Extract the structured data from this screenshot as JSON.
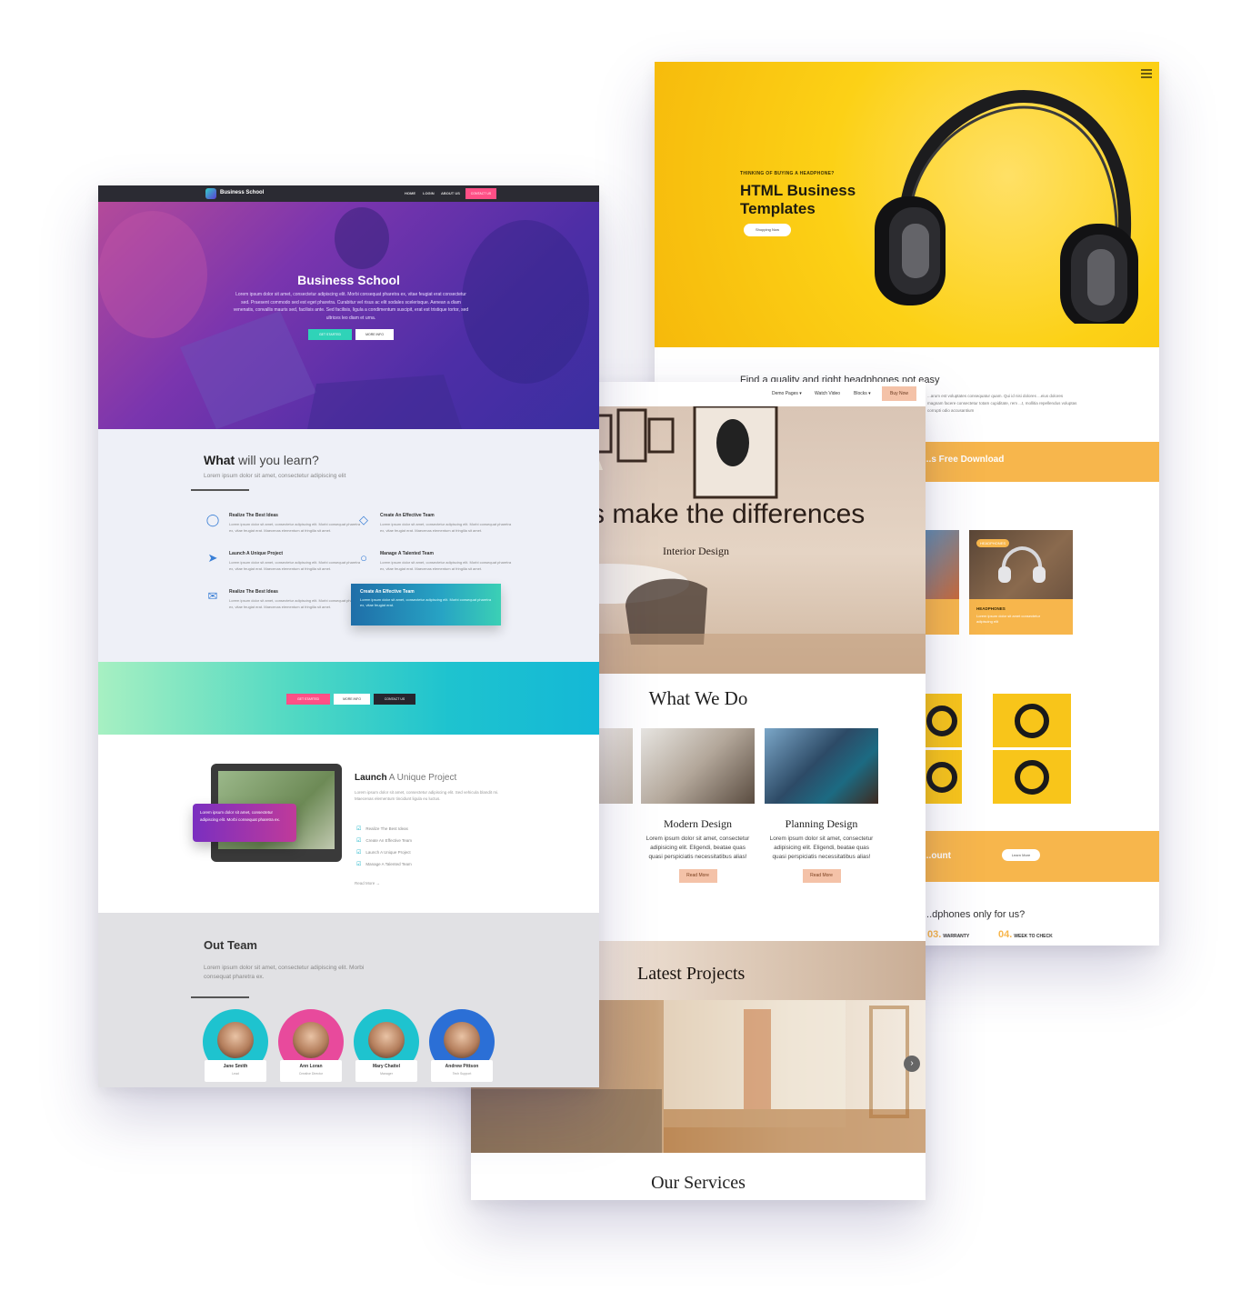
{
  "headphones_template": {
    "kicker": "THINKING OF BUYING A HEADPHONE?",
    "title": "HTML Business Templates",
    "shop_button": "Shopping Now",
    "intro_heading": "Find a quality and right headphones not easy",
    "intro_text": "...arum est voluptates consequatur quam. Qui id nisi dolores ...eius dolores magnam facere consectetur totam cupiditate, rem ...t, mollitia repellendus voluptas corrupti odio accusantium",
    "download_band": "...s Free Download",
    "product": {
      "tag": "HEADPHONES",
      "name": "HEADPHONES",
      "desc": "Lorem ipsum dolor sit amet consectetur adipiscing elit"
    },
    "discount_band": "...ount",
    "learn_more": "Learn More",
    "question": "...dphones only for us?",
    "stats": [
      {
        "num": "03.",
        "label": "WARRANTY"
      },
      {
        "num": "04.",
        "label": "WEEK TO CHECK"
      }
    ],
    "accent": "#f7b64c"
  },
  "interior_template": {
    "nav": {
      "demo_pages": "Demo Pages ▾",
      "watch_video": "Watch Video",
      "blocks": "Blocks ▾",
      "buy_now": "Buy Now"
    },
    "hero_title": "s make the differences",
    "hero_subtitle": "Interior Design",
    "what_we_do": "What We Do",
    "services": [
      {
        "name": "Modern Design",
        "desc": "Lorem ipsum dolor sit amet, consectetur adipisicing elit. Eligendi, beatae quas quasi perspiciatis necessitatibus alias!",
        "button": "Read More"
      },
      {
        "name": "Planning Design",
        "desc": "Lorem ipsum dolor sit amet, consectetur adipisicing elit. Eligendi, beatae quas quasi perspiciatis necessitatibus alias!",
        "button": "Read More"
      }
    ],
    "latest_projects": "Latest Projects",
    "our_services": "Our Services",
    "accent": "#f4c2a8"
  },
  "business_template": {
    "nav": {
      "brand": "Business School",
      "links": [
        "HOME",
        "LOGIN",
        "ABOUT US"
      ],
      "contact": "CONTACT US"
    },
    "hero": {
      "title": "Business School",
      "desc": "Lorem ipsum dolor sit amet, consectetur adipiscing elit. Morbi consequat pharetra ex, vitae feugiat erat consectetur sed. Praesent commodo sed est eget pharetra. Curabitur vel risus ac elit sodales scelerisque. Aenean a diam venenatis, convallis mauris sed, facilisis ante. Sed facilisis, ligula a condimentum suscipit, erat est tristique tortor, sed ultrices leo diam et urna.",
      "btn1": "GET STARTED",
      "btn2": "MORE INFO"
    },
    "learn": {
      "heading_bold": "What",
      "heading_rest": " will you learn?",
      "sub": "Lorem ipsum dolor sit amet, consectetur adipiscing elit",
      "features": [
        {
          "title": "Realize The Best Ideas",
          "desc": "Lorem ipsum dolor sit amet, consectetur adipiscing elit. Morbi consequat pharetra ex, vitae feugiat erat. Maecenas elementum at fringilla sit amet."
        },
        {
          "title": "Create An Effective Team",
          "desc": "Lorem ipsum dolor sit amet, consectetur adipiscing elit. Morbi consequat pharetra ex, vitae feugiat erat. Maecenas elementum at fringilla sit amet."
        },
        {
          "title": "Launch A Unique Project",
          "desc": "Lorem ipsum dolor sit amet, consectetur adipiscing elit. Morbi consequat pharetra ex, vitae feugiat erat. Maecenas elementum at fringilla sit amet."
        },
        {
          "title": "Manage A Talented Team",
          "desc": "Lorem ipsum dolor sit amet, consectetur adipiscing elit. Morbi consequat pharetra ex, vitae feugiat erat. Maecenas elementum at fringilla sit amet."
        },
        {
          "title": "Realize The Best Ideas",
          "desc": "Lorem ipsum dolor sit amet, consectetur adipiscing elit. Morbi consequat pharetra ex, vitae feugiat erat. Maecenas elementum at fringilla sit amet."
        }
      ],
      "card": {
        "title": "Create An Effective Team",
        "desc": "Lorem ipsum dolor sit amet, consectetur adipiscing elit. Morbi consequat pharetra ex, vitae feugiat erat."
      }
    },
    "band_buttons": [
      "GET STARTED",
      "MORE INFO",
      "CONTACT US"
    ],
    "launch": {
      "title_bold": "Launch",
      "title_rest": " A Unique Project",
      "desc": "Lorem ipsum dolor sit amet, consectetur adipiscing elit. Sed vehicula blandit mi. Maecenas elementum tincidunt ligula eu luctus.",
      "card": "Lorem ipsum dolor sit amet, consectetur adipiscing elit. Morbi consequat pharetra ex.",
      "checks": [
        "Realize The Best Ideas",
        "Create An Effective Team",
        "Launch A Unique Project",
        "Manage A Talented Team"
      ],
      "read_more": "Read More →"
    },
    "team": {
      "title": "Out Team",
      "desc": "Lorem ipsum dolor sit amet, consectetur adipiscing elit. Morbi consequat pharetra ex.",
      "members": [
        {
          "name": "Jane Smith",
          "role": "Lead",
          "ring": "#1ec3cf"
        },
        {
          "name": "Ann Loran",
          "role": "Creative Director",
          "ring": "#e84a9c"
        },
        {
          "name": "Mary Chattel",
          "role": "Manager",
          "ring": "#1ec3cf"
        },
        {
          "name": "Andrew Pittson",
          "role": "Tech Support",
          "ring": "#2b6fd6"
        }
      ]
    }
  }
}
